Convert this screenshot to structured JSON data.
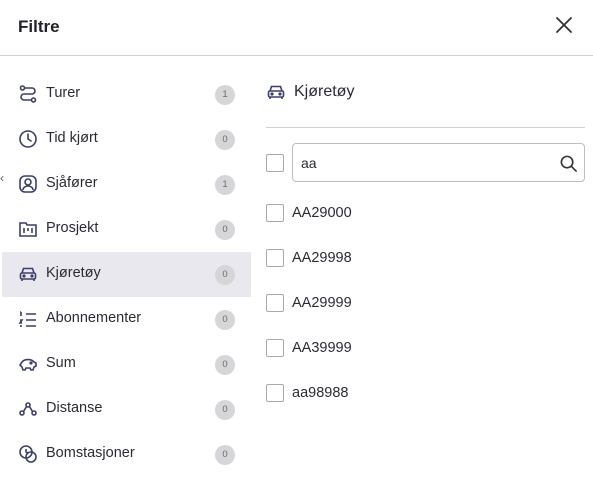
{
  "dialog": {
    "title": "Filtre",
    "edge_glyph": "‹"
  },
  "sidebar": {
    "items": [
      {
        "label": "Turer",
        "count": "1",
        "icon": "route-icon",
        "active": false
      },
      {
        "label": "Tid kjørt",
        "count": "0",
        "icon": "clock-icon",
        "active": false
      },
      {
        "label": "Sjåfører",
        "count": "1",
        "icon": "user-circle-icon",
        "active": false
      },
      {
        "label": "Prosjekt",
        "count": "0",
        "icon": "project-icon",
        "active": false
      },
      {
        "label": "Kjøretøy",
        "count": "0",
        "icon": "car-icon",
        "active": true
      },
      {
        "label": "Abonnementer",
        "count": "0",
        "icon": "list-numbered-icon",
        "active": false
      },
      {
        "label": "Sum",
        "count": "0",
        "icon": "piggy-bank-icon",
        "active": false
      },
      {
        "label": "Distanse",
        "count": "0",
        "icon": "distance-icon",
        "active": false
      },
      {
        "label": "Bomstasjoner",
        "count": "0",
        "icon": "toll-icon",
        "active": false
      }
    ]
  },
  "panel": {
    "title": "Kjøretøy",
    "icon": "car-icon",
    "search": {
      "value": "aa",
      "placeholder": ""
    },
    "options": [
      {
        "label": "AA29000",
        "checked": false
      },
      {
        "label": "AA29998",
        "checked": false
      },
      {
        "label": "AA29999",
        "checked": false
      },
      {
        "label": "AA39999",
        "checked": false
      },
      {
        "label": "aa98988",
        "checked": false
      }
    ]
  },
  "colors": {
    "active_bg": "#e8e8ee",
    "badge_bg": "#d6d6d9",
    "divider": "#cfcfd4",
    "text": "#2b2b33"
  }
}
